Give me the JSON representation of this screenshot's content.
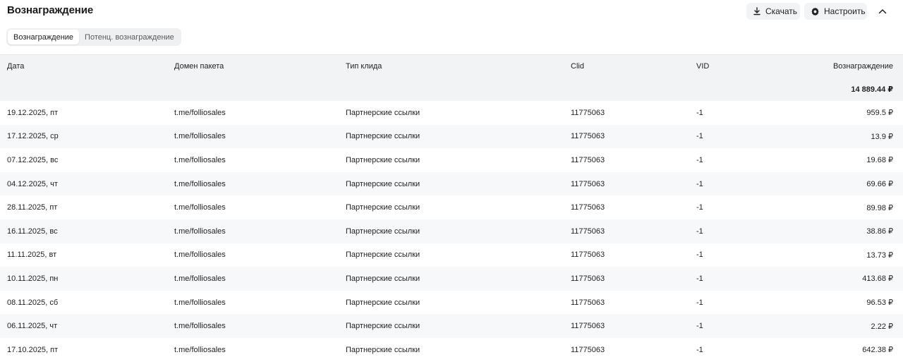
{
  "header": {
    "title": "Вознаграждение",
    "download_label": "Скачать",
    "settings_label": "Настроить",
    "icons": {
      "download": "download-icon",
      "settings": "gear-icon",
      "collapse": "chevron-up-icon"
    }
  },
  "tabs": [
    {
      "label": "Вознаграждение",
      "active": true
    },
    {
      "label": "Потенц. вознаграждение",
      "active": false
    }
  ],
  "table": {
    "columns": [
      "Дата",
      "Домен пакета",
      "Тип клида",
      "Clid",
      "VID",
      "Вознаграждение"
    ],
    "total": "14 889.44 ₽",
    "rows": [
      {
        "date": "19.12.2025, пт",
        "domain": "t.me/folliosales",
        "type": "Партнерские ссылки",
        "clid": "11775063",
        "vid": "-1",
        "reward": "959.5 ₽"
      },
      {
        "date": "17.12.2025, ср",
        "domain": "t.me/folliosales",
        "type": "Партнерские ссылки",
        "clid": "11775063",
        "vid": "-1",
        "reward": "13.9 ₽"
      },
      {
        "date": "07.12.2025, вс",
        "domain": "t.me/folliosales",
        "type": "Партнерские ссылки",
        "clid": "11775063",
        "vid": "-1",
        "reward": "19.68 ₽"
      },
      {
        "date": "04.12.2025, чт",
        "domain": "t.me/folliosales",
        "type": "Партнерские ссылки",
        "clid": "11775063",
        "vid": "-1",
        "reward": "69.66 ₽"
      },
      {
        "date": "28.11.2025, пт",
        "domain": "t.me/folliosales",
        "type": "Партнерские ссылки",
        "clid": "11775063",
        "vid": "-1",
        "reward": "89.98 ₽"
      },
      {
        "date": "16.11.2025, вс",
        "domain": "t.me/folliosales",
        "type": "Партнерские ссылки",
        "clid": "11775063",
        "vid": "-1",
        "reward": "38.86 ₽"
      },
      {
        "date": "11.11.2025, вт",
        "domain": "t.me/folliosales",
        "type": "Партнерские ссылки",
        "clid": "11775063",
        "vid": "-1",
        "reward": "13.73 ₽"
      },
      {
        "date": "10.11.2025, пн",
        "domain": "t.me/folliosales",
        "type": "Партнерские ссылки",
        "clid": "11775063",
        "vid": "-1",
        "reward": "413.68 ₽"
      },
      {
        "date": "08.11.2025, сб",
        "domain": "t.me/folliosales",
        "type": "Партнерские ссылки",
        "clid": "11775063",
        "vid": "-1",
        "reward": "96.53 ₽"
      },
      {
        "date": "06.11.2025, чт",
        "domain": "t.me/folliosales",
        "type": "Партнерские ссылки",
        "clid": "11775063",
        "vid": "-1",
        "reward": "2.22 ₽"
      },
      {
        "date": "17.10.2025, пт",
        "domain": "t.me/folliosales",
        "type": "Партнерские ссылки",
        "clid": "11775063",
        "vid": "-1",
        "reward": "642.38 ₽"
      }
    ]
  }
}
